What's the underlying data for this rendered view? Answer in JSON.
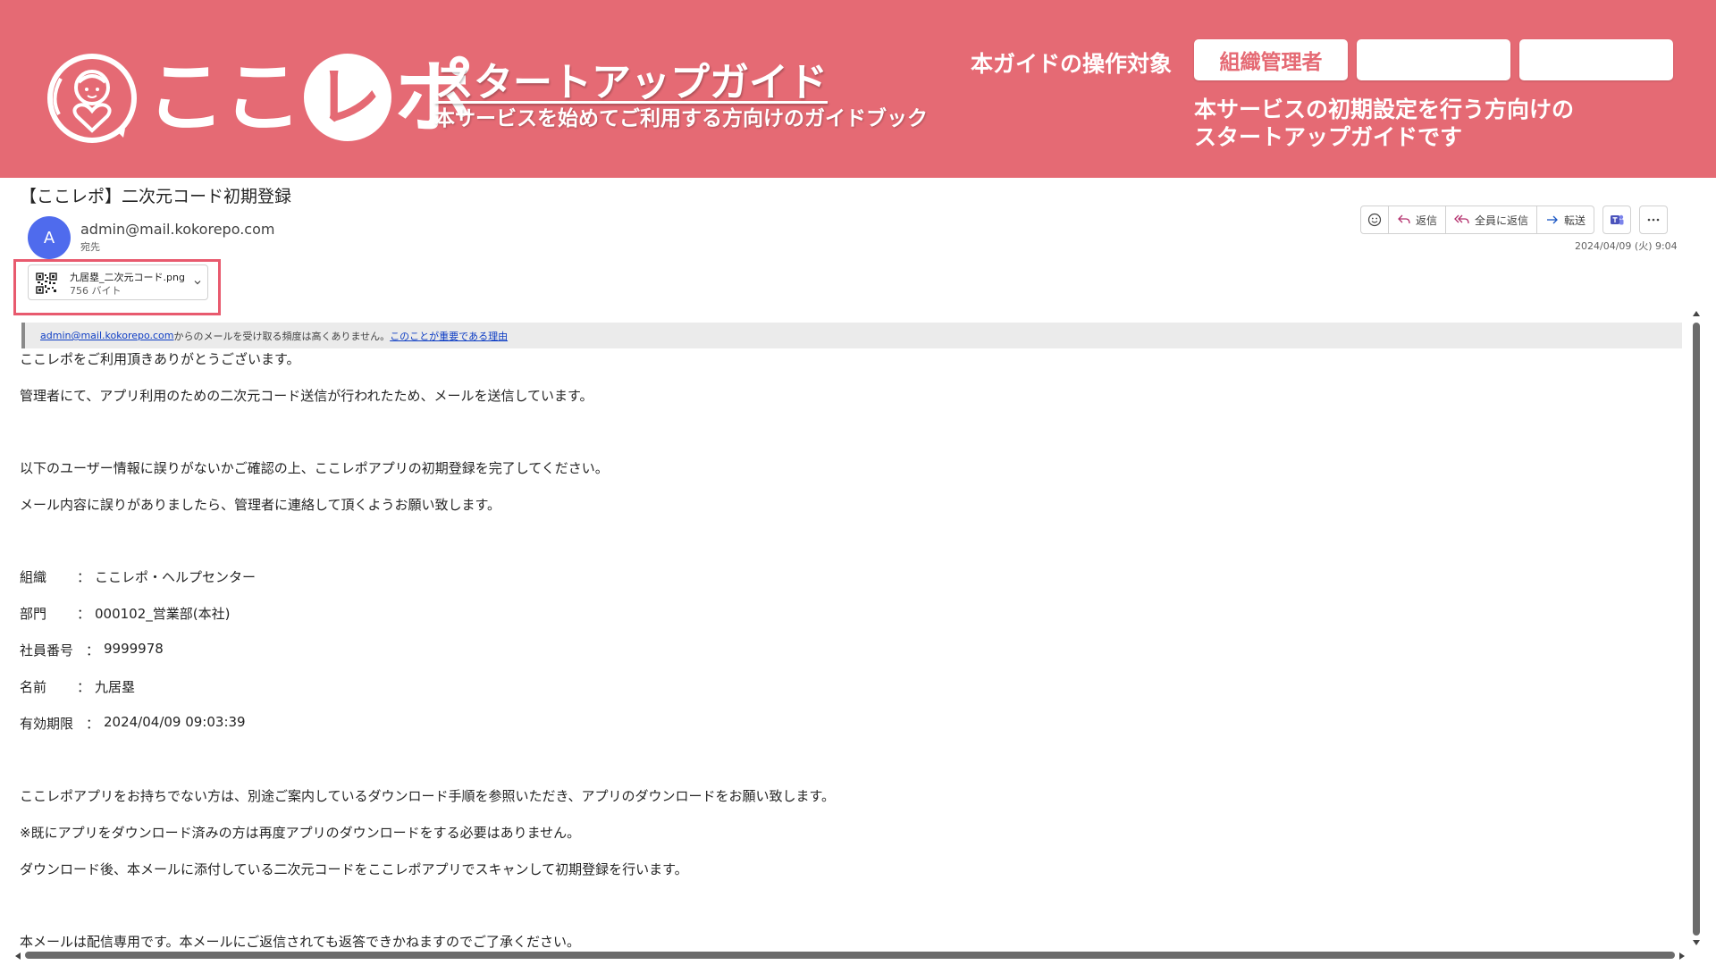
{
  "banner": {
    "brand_text_left": "ここ",
    "brand_text_circle": "レ",
    "brand_text_right": "ポ",
    "title": "スタートアップガイド",
    "subtitle": "本サービスを始めてご利用する方向けのガイドブック",
    "target_label": "本ガイドの操作対象",
    "role_tabs": [
      "組織管理者",
      "",
      ""
    ],
    "role_description_line1": "本サービスの初期設定を行う方向けの",
    "role_description_line2": "スタートアップガイドです",
    "colors": {
      "background": "#e56a74",
      "text": "#ffffff"
    }
  },
  "email": {
    "subject": "【ここレポ】二次元コード初期登録",
    "avatar_initial": "A",
    "sender": "admin@mail.kokorepo.com",
    "recipient_label": "宛先",
    "toolbar": {
      "reply": "返信",
      "reply_all": "全員に返信",
      "forward": "転送"
    },
    "date": "2024/04/09 (火) 9:04",
    "attachment": {
      "name": "九居塁_二次元コード.png",
      "size": "756 バイト"
    },
    "notice": {
      "email_link": "admin@mail.kokorepo.com",
      "text": " からのメールを受け取る頻度は高くありません。",
      "reason_link": "このことが重要である理由"
    },
    "body": {
      "greeting": "ここレポをご利用頂きありがとうございます。",
      "line1": "管理者にて、アプリ利用のための二次元コード送信が行われたため、メールを送信しています。",
      "line2": "以下のユーザー情報に誤りがないかご確認の上、ここレポアプリの初期登録を完了してください。",
      "line3": "メール内容に誤りがありましたら、管理者に連絡して頂くようお願い致します。",
      "info": [
        {
          "key": "組織",
          "sep": "：",
          "value": "ここレポ・ヘルプセンター"
        },
        {
          "key": "部門",
          "sep": "：",
          "value": "000102_営業部(本社)"
        },
        {
          "key": "社員番号",
          "sep": "：",
          "value": "9999978"
        },
        {
          "key": "名前",
          "sep": "：",
          "value": "九居塁"
        },
        {
          "key": "有効期限",
          "sep": "：",
          "value": "2024/04/09 09:03:39"
        }
      ],
      "line4": "ここレポアプリをお持ちでない方は、別途ご案内しているダウンロード手順を参照いただき、アプリのダウンロードをお願い致します。",
      "line5": "※既にアプリをダウンロード済みの方は再度アプリのダウンロードをする必要はありません。",
      "line6": "ダウンロード後、本メールに添付している二次元コードをここレポアプリでスキャンして初期登録を行います。",
      "line7": "本メールは配信専用です。本メールにご返信されても返答できかねますのでご了承ください。"
    }
  },
  "icons": [
    "heart-person-logo-icon",
    "emoji-icon",
    "reply-icon",
    "reply-all-icon",
    "forward-icon",
    "teams-icon",
    "more-icon",
    "qr-code-icon",
    "chevron-down-icon"
  ]
}
